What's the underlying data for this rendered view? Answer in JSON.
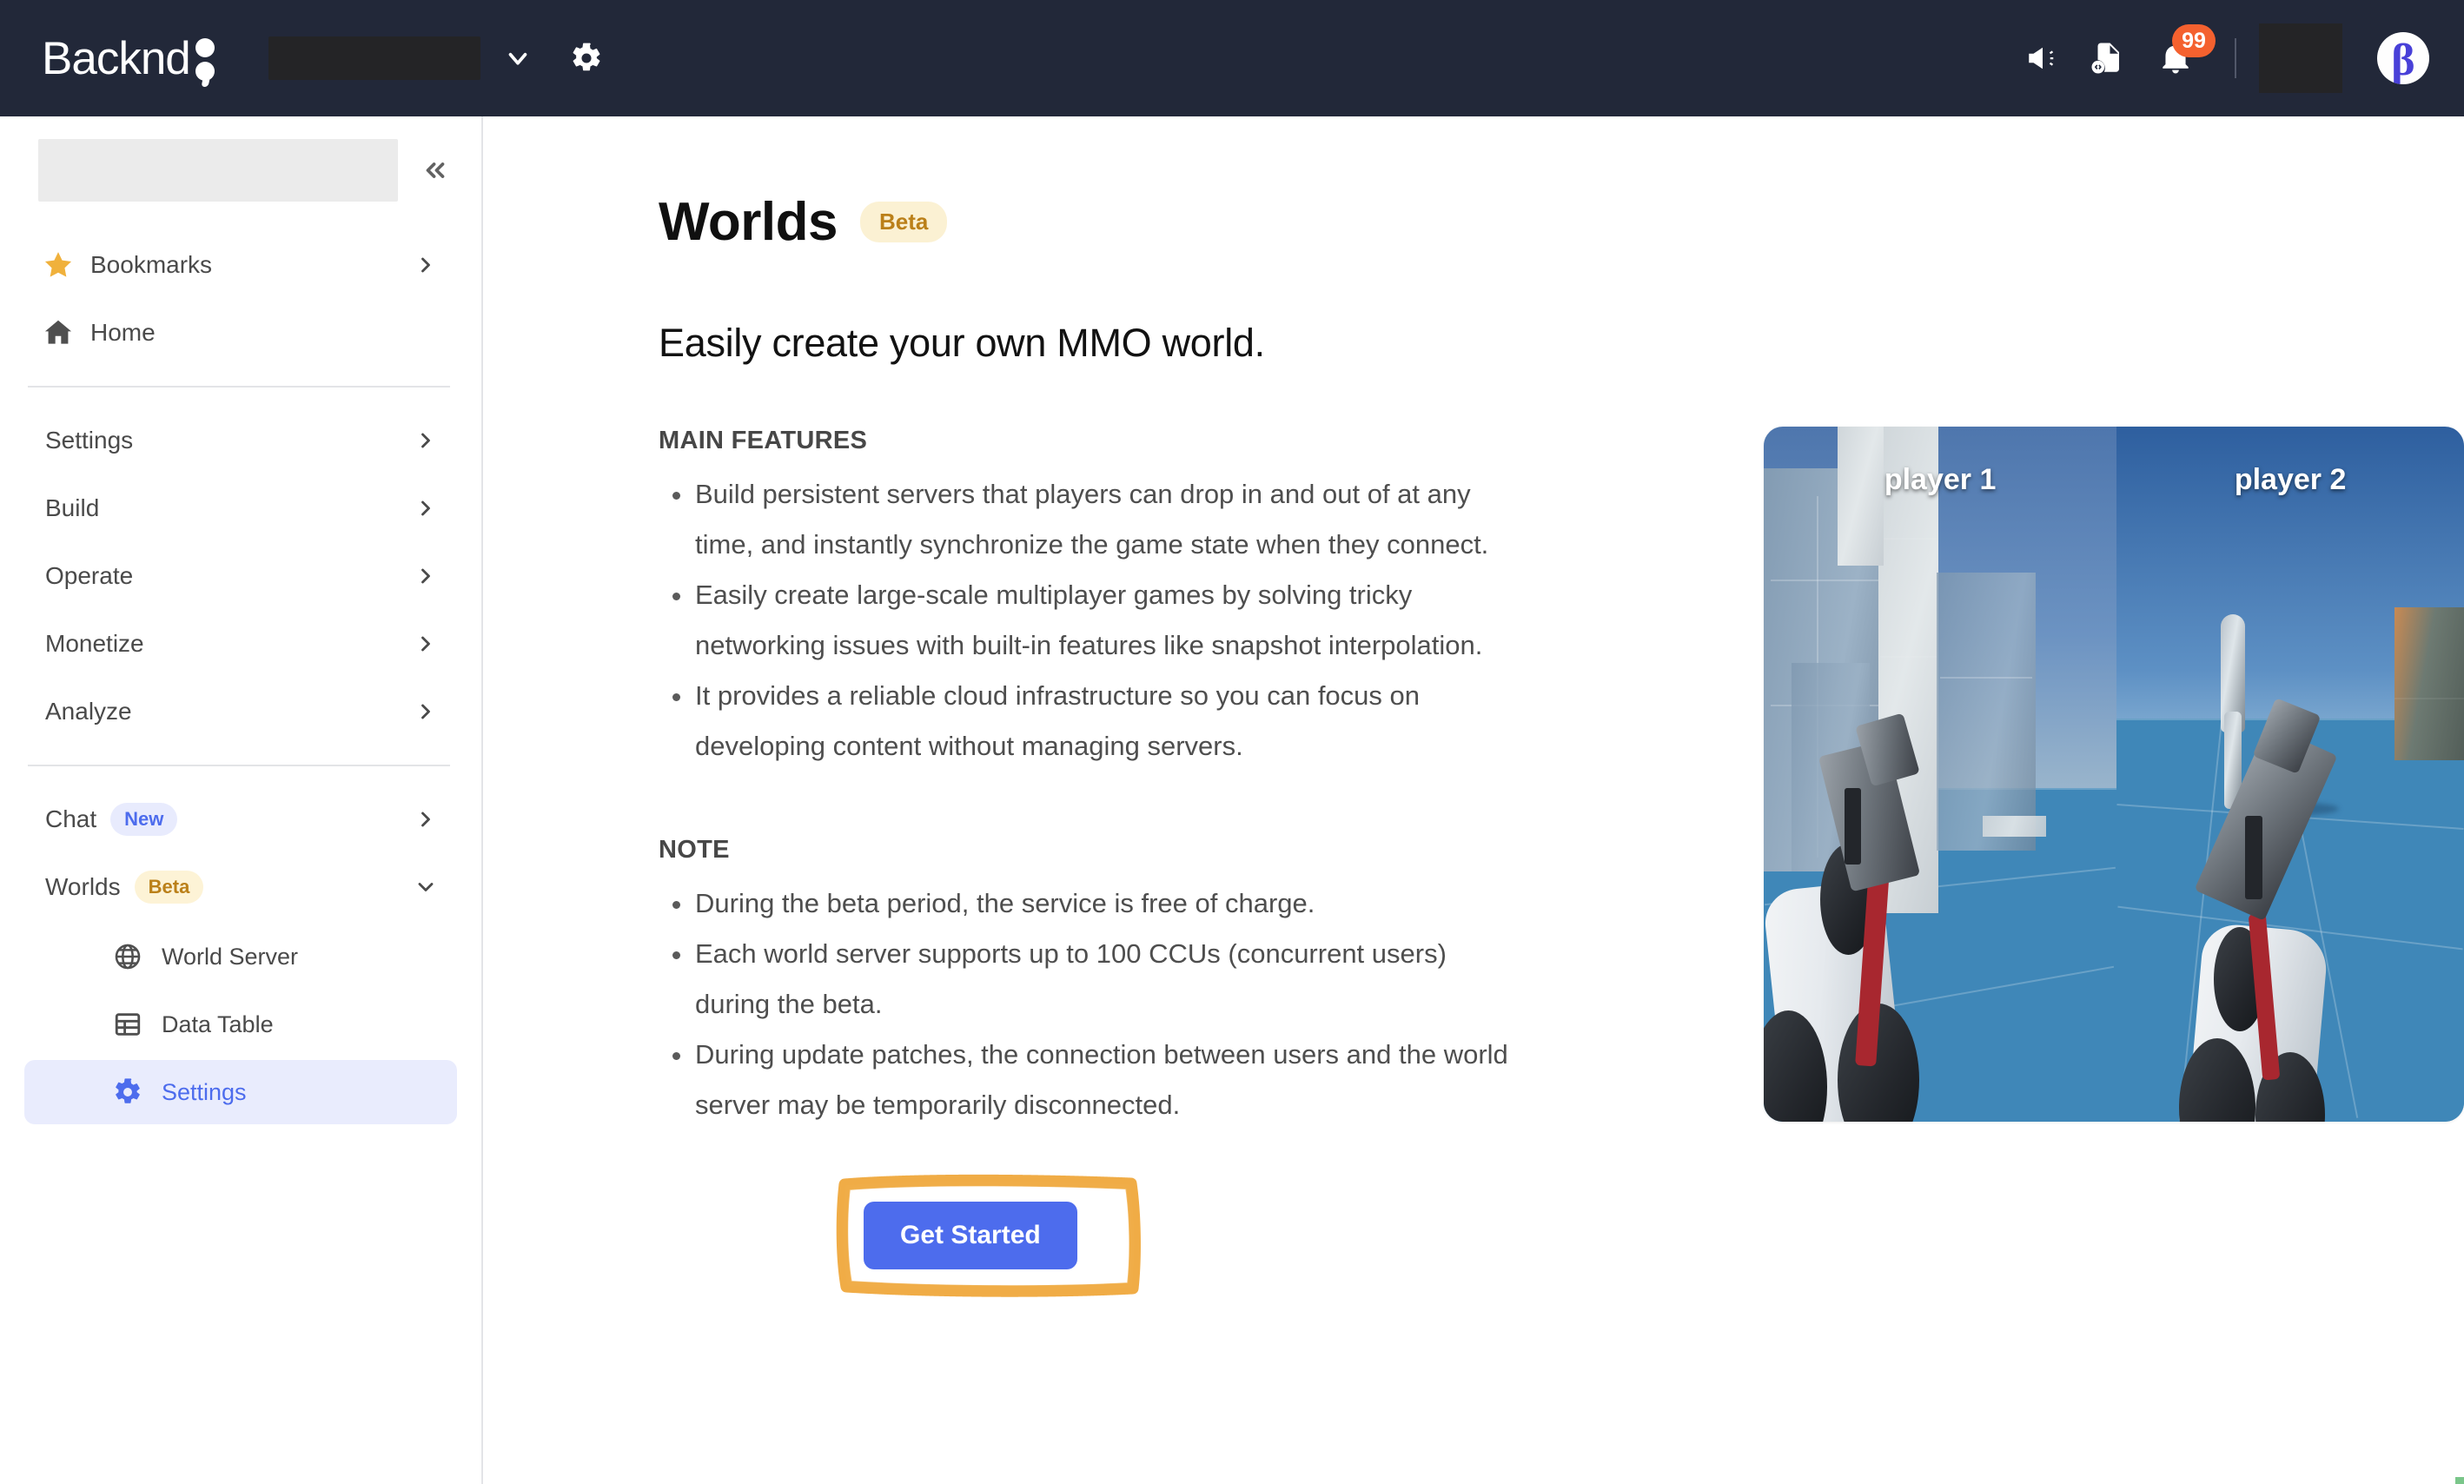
{
  "topbar": {
    "logo_text": "Backnd",
    "logo_mark_icon": "two-dots-mark",
    "project_selector_value": "",
    "project_chevron_icon": "chevron-down-icon",
    "settings_gear_icon": "gear-icon",
    "announcement_icon": "megaphone-icon",
    "docs_icon": "document-code-icon",
    "notifications_icon": "bell-icon",
    "notification_count": "99",
    "account_redacted_value": "",
    "avatar_icon": "beta-avatar",
    "avatar_letter": "β",
    "accent_navy": "#222839",
    "badge_color": "#f4612f"
  },
  "sidebar": {
    "workspace_redacted_value": "",
    "collapse_icon": "chevrons-left-icon",
    "quick": [
      {
        "label": "Bookmarks",
        "icon": "star-icon",
        "chevron": "chevron-right-icon"
      },
      {
        "label": "Home",
        "icon": "home-icon",
        "chevron": ""
      }
    ],
    "groups": [
      {
        "label": "Settings",
        "chevron": "chevron-right-icon"
      },
      {
        "label": "Build",
        "chevron": "chevron-right-icon"
      },
      {
        "label": "Operate",
        "chevron": "chevron-right-icon"
      },
      {
        "label": "Monetize",
        "chevron": "chevron-right-icon"
      },
      {
        "label": "Analyze",
        "chevron": "chevron-right-icon"
      }
    ],
    "chat": {
      "label": "Chat",
      "badge": "New",
      "chevron": "chevron-right-icon"
    },
    "worlds": {
      "label": "Worlds",
      "badge": "Beta",
      "chevron": "chevron-down-icon"
    },
    "worlds_children": [
      {
        "label": "World Server",
        "icon": "globe-icon",
        "active": false
      },
      {
        "label": "Data Table",
        "icon": "table-icon",
        "active": false
      },
      {
        "label": "Settings",
        "icon": "gear-icon",
        "active": true
      }
    ],
    "active_color": "#4d6ced",
    "active_bg": "#e9ecfd"
  },
  "main": {
    "title": "Worlds",
    "title_badge": "Beta",
    "subtitle": "Easily create your own MMO world.",
    "features_heading": "MAIN FEATURES",
    "features": [
      "Build persistent servers that players can drop in and out of at any time, and instantly synchronize the game state when they connect.",
      "Easily create large-scale multiplayer games by solving tricky networking issues with built-in features like snapshot interpolation.",
      "It provides a reliable cloud infrastructure so you can focus on developing content without managing servers."
    ],
    "note_heading": "NOTE",
    "notes": [
      "During the beta period, the service is free of charge.",
      "Each world server supports up to 100 CCUs (concurrent users) during the beta.",
      "During update patches, the connection between users and the world server may be temporarily disconnected."
    ],
    "cta_label": "Get Started",
    "cta_color": "#4d6ced",
    "annotation_color": "#efa83c",
    "annotation_shape": "hand-drawn-rectangle"
  },
  "preview": {
    "left_player_label": "player 1",
    "right_player_label": "player 2",
    "description": "split-screen first-person multiplayer gameplay preview"
  }
}
